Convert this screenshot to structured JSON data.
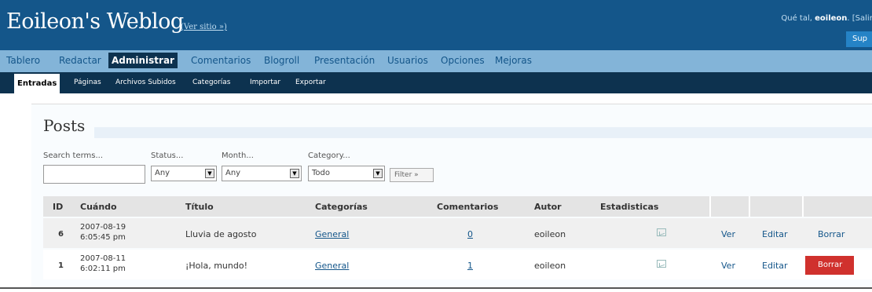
{
  "header": {
    "blog_title": "Eoileon's Weblog",
    "view_site": "(Ver sitio »)",
    "greeting_prefix": "Qué tal, ",
    "username": "eoileon",
    "greeting_suffix": ". [Salir, ",
    "support_button": "Sup"
  },
  "menu": {
    "items": [
      "Tablero",
      "Redactar",
      "Administrar",
      "Comentarios",
      "Blogroll",
      "Presentación",
      "Usuarios",
      "Opciones",
      "Mejoras"
    ],
    "active": "Administrar"
  },
  "submenu": {
    "items": [
      "Entradas",
      "Páginas",
      "Archivos Subidos",
      "Categorías",
      "Importar",
      "Exportar"
    ],
    "active": "Entradas"
  },
  "page": {
    "title": "Posts"
  },
  "filters": {
    "search_label": "Search terms...",
    "search_value": "",
    "status_label": "Status...",
    "status_value": "Any",
    "month_label": "Month...",
    "month_value": "Any",
    "category_label": "Category...",
    "category_value": "Todo",
    "filter_button": "Filter »"
  },
  "table": {
    "headers": [
      "ID",
      "Cuándo",
      "Título",
      "Categorías",
      "Comentarios",
      "Autor",
      "Estadisticas"
    ],
    "rows": [
      {
        "id": "6",
        "date": "2007-08-19",
        "time": "6:05:45 pm",
        "title": "Lluvia de agosto",
        "category": "General",
        "comments": "0",
        "author": "eoileon",
        "view": "Ver",
        "edit": "Editar",
        "delete": "Borrar"
      },
      {
        "id": "1",
        "date": "2007-08-11",
        "time": "6:02:11 pm",
        "title": "¡Hola, mundo!",
        "category": "General",
        "comments": "1",
        "author": "eoileon",
        "view": "Ver",
        "edit": "Editar",
        "delete": "Borrar"
      }
    ]
  },
  "icons": {
    "stats": "chart-icon",
    "dropdown": "chevron-down-icon"
  },
  "colors": {
    "header_bg": "#14568a",
    "menu_bg": "#83b4d8",
    "submenu_bg": "#0d324f",
    "delete_active": "#d0312d"
  }
}
